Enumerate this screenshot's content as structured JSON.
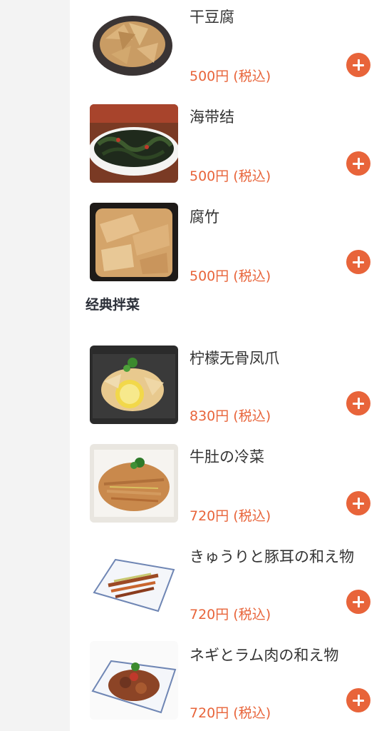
{
  "section": {
    "title": "经典拌菜"
  },
  "items": [
    {
      "name": "干豆腐",
      "price": "500円 (税込)"
    },
    {
      "name": "海带结",
      "price": "500円 (税込)"
    },
    {
      "name": "腐竹",
      "price": "500円 (税込)"
    },
    {
      "name": "柠檬无骨凤爪",
      "price": "830円 (税込)"
    },
    {
      "name": "牛肚の冷菜",
      "price": "720円 (税込)"
    },
    {
      "name": "きゅうりと豚耳の和え物",
      "price": "720円 (税込)"
    },
    {
      "name": "ネギとラム肉の和え物",
      "price": "720円 (税込)"
    }
  ],
  "colors": {
    "accent": "#e8643a",
    "sidebar": "#f3f3f3",
    "text": "#333333"
  },
  "icons": {
    "add": "plus-circle-icon"
  }
}
